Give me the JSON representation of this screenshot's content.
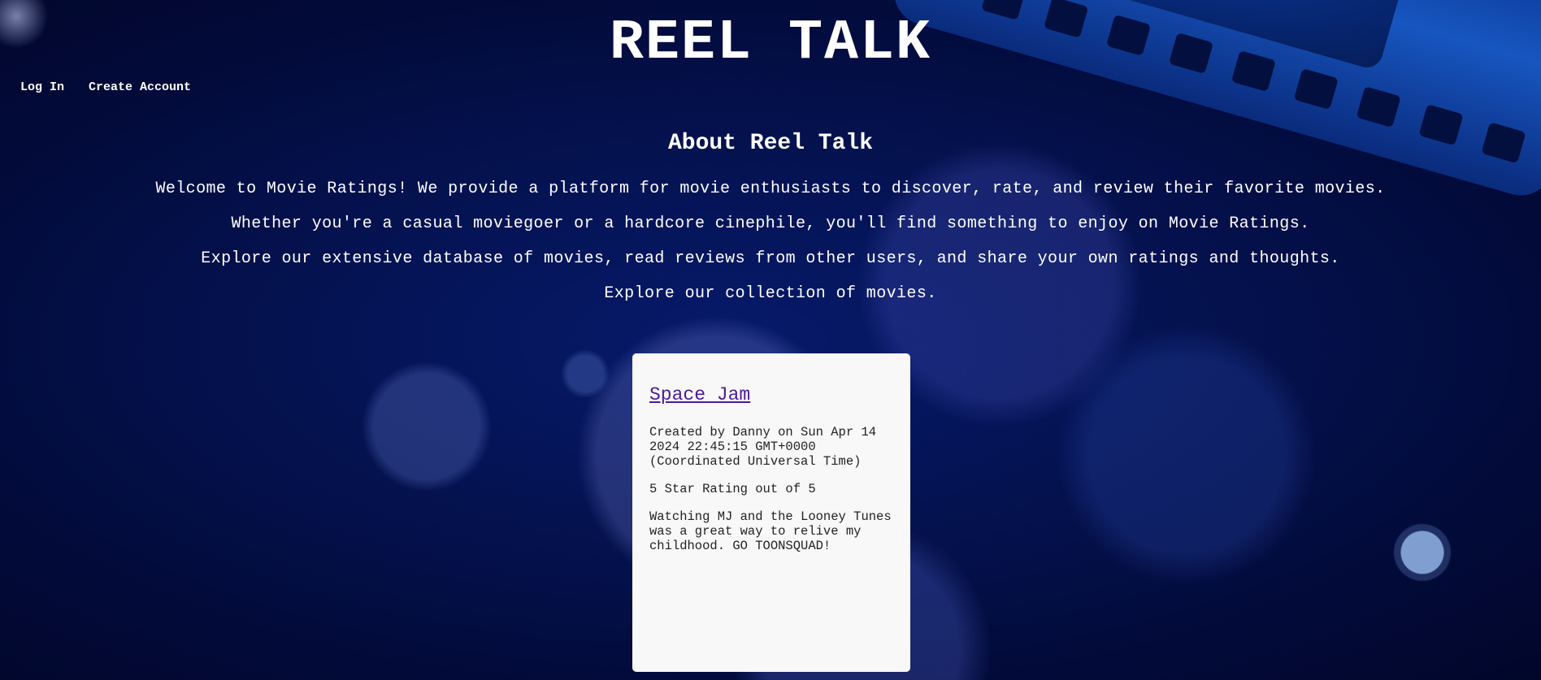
{
  "header": {
    "title": "REEL TALK"
  },
  "nav": {
    "login_label": "Log In",
    "create_account_label": "Create Account"
  },
  "about": {
    "heading": "About Reel Talk",
    "paragraphs": [
      "Welcome to Movie Ratings! We provide a platform for movie enthusiasts to discover, rate, and review their favorite movies.",
      "Whether you're a casual moviegoer or a hardcore cinephile, you'll find something to enjoy on Movie Ratings.",
      "Explore our extensive database of movies, read reviews from other users, and share your own ratings and thoughts.",
      "Explore our collection of movies."
    ]
  },
  "movies": [
    {
      "title": "Space Jam",
      "created": "Created by Danny on Sun Apr 14 2024 22:45:15 GMT+0000 (Coordinated Universal Time)",
      "rating": "5 Star Rating out of 5",
      "review": "Watching MJ and the Looney Tunes was a great way to relive my childhood. GO TOONSQUAD!"
    }
  ],
  "colors": {
    "background": "#041250",
    "card_background": "#f8f8f8",
    "link": "#4b1a9a",
    "text": "#ffffff"
  }
}
